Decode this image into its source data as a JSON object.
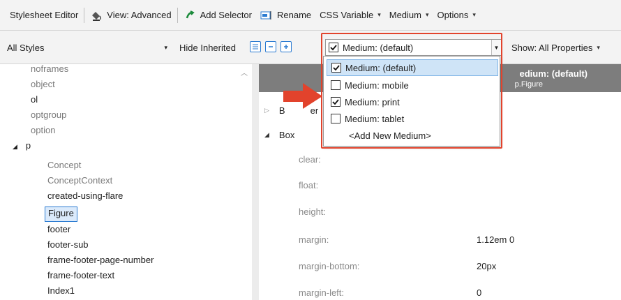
{
  "toolbar": {
    "title": "Stylesheet Editor",
    "view_label": "View: Advanced",
    "add_selector_label": "Add Selector",
    "rename_label": "Rename",
    "css_variable_label": "CSS Variable",
    "medium_label": "Medium",
    "options_label": "Options"
  },
  "filter_bar": {
    "all_styles": "All Styles",
    "hide_inherited": "Hide Inherited",
    "show_properties": "Show: All Properties",
    "medium_selected": "Medium: (default)"
  },
  "medium_menu": {
    "items": [
      {
        "label": "Medium: (default)",
        "checked": true,
        "highlighted": true
      },
      {
        "label": "Medium: mobile",
        "checked": false
      },
      {
        "label": "Medium: print",
        "checked": true
      },
      {
        "label": "Medium: tablet",
        "checked": false
      }
    ],
    "add_new": "<Add New Medium>"
  },
  "tree": {
    "items": [
      {
        "label": "noframes",
        "muted": true
      },
      {
        "label": "object",
        "muted": true
      },
      {
        "label": "ol",
        "muted": false
      },
      {
        "label": "optgroup",
        "muted": true
      },
      {
        "label": "option",
        "muted": true
      },
      {
        "label": "p",
        "muted": false
      },
      {
        "label": "Concept",
        "muted": true
      },
      {
        "label": "ConceptContext",
        "muted": true
      },
      {
        "label": "created-using-flare",
        "muted": false
      },
      {
        "label": "Figure",
        "muted": false,
        "selected": true
      },
      {
        "label": "footer",
        "muted": false
      },
      {
        "label": "footer-sub",
        "muted": false
      },
      {
        "label": "frame-footer-page-number",
        "muted": false
      },
      {
        "label": "frame-footer-text",
        "muted": false
      },
      {
        "label": "Index1",
        "muted": false
      }
    ]
  },
  "properties": {
    "header_title": "Medium: (default)",
    "header_title_visible": "edium: (default)",
    "header_selector": "p.Figure",
    "groups": [
      {
        "label": "Border",
        "visible_fragment_left": "B",
        "visible_fragment_right": "er"
      },
      {
        "label": "Box"
      }
    ],
    "rows": [
      {
        "name": "clear:",
        "value": ""
      },
      {
        "name": "float:",
        "value": ""
      },
      {
        "name": "height:",
        "value": ""
      },
      {
        "name": "margin:",
        "value": "1.12em 0"
      },
      {
        "name": "margin-bottom:",
        "value": "20px"
      },
      {
        "name": "margin-left:",
        "value": "0"
      }
    ]
  },
  "colors": {
    "callout": "#e2432c",
    "accent": "#2b7bd1",
    "header_bg": "#7d7d7d",
    "highlight": "#cfe4f7"
  }
}
